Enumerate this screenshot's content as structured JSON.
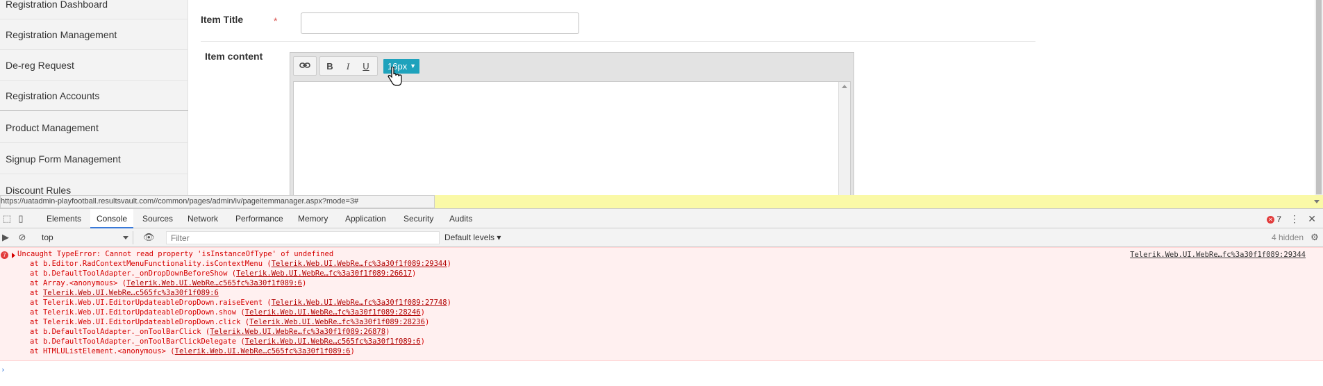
{
  "sidebar": {
    "items": [
      {
        "label": "Registration Dashboard"
      },
      {
        "label": "Registration Management"
      },
      {
        "label": "De-reg Request"
      },
      {
        "label": "Registration Accounts"
      },
      {
        "label": "Product Management"
      },
      {
        "label": "Signup Form Management"
      },
      {
        "label": "Discount Rules"
      }
    ]
  },
  "form": {
    "item_title_label": "Item Title",
    "required_mark": "*",
    "item_title_value": "",
    "item_content_label": "Item content"
  },
  "editor": {
    "toolbar": {
      "link_icon": "link-icon",
      "bold": "B",
      "italic": "I",
      "underline": "U",
      "font_size": "16px"
    }
  },
  "status_bar": {
    "url": "https://uatadmin-playfootball.resultsvault.com//common/pages/admin/iv/pageitemmanager.aspx?mode=3#"
  },
  "devtools": {
    "tabs": [
      "Elements",
      "Console",
      "Sources",
      "Network",
      "Performance",
      "Memory",
      "Application",
      "Security",
      "Audits"
    ],
    "active_tab": "Console",
    "error_count": "7",
    "context": "top",
    "filter_placeholder": "Filter",
    "levels": "Default levels",
    "hidden": "4 hidden",
    "console": {
      "error_count_badge": "7",
      "error_message": "Uncaught TypeError: Cannot read property 'isInstanceOfType' of undefined",
      "source_link": "Telerik.Web.UI.WebRe…fc%3a30f1f089:29344",
      "stack": [
        {
          "prefix": "at b.Editor.RadContextMenuFunctionality.isContextMenu (",
          "link": "Telerik.Web.UI.WebRe…fc%3a30f1f089:29344",
          "suffix": ")"
        },
        {
          "prefix": "at b.DefaultToolAdapter._onDropDownBeforeShow (",
          "link": "Telerik.Web.UI.WebRe…fc%3a30f1f089:26617",
          "suffix": ")"
        },
        {
          "prefix": "at Array.<anonymous> (",
          "link": "Telerik.Web.UI.WebRe…c565fc%3a30f1f089:6",
          "suffix": ")"
        },
        {
          "prefix": "at ",
          "link": "Telerik.Web.UI.WebRe…c565fc%3a30f1f089:6",
          "suffix": ""
        },
        {
          "prefix": "at Telerik.Web.UI.EditorUpdateableDropDown.raiseEvent (",
          "link": "Telerik.Web.UI.WebRe…fc%3a30f1f089:27748",
          "suffix": ")"
        },
        {
          "prefix": "at Telerik.Web.UI.EditorUpdateableDropDown.show (",
          "link": "Telerik.Web.UI.WebRe…fc%3a30f1f089:28246",
          "suffix": ")"
        },
        {
          "prefix": "at Telerik.Web.UI.EditorUpdateableDropDown.click (",
          "link": "Telerik.Web.UI.WebRe…fc%3a30f1f089:28236",
          "suffix": ")"
        },
        {
          "prefix": "at b.DefaultToolAdapter._onToolBarClick (",
          "link": "Telerik.Web.UI.WebRe…fc%3a30f1f089:26878",
          "suffix": ")"
        },
        {
          "prefix": "at b.DefaultToolAdapter._onToolBarClickDelegate (",
          "link": "Telerik.Web.UI.WebRe…c565fc%3a30f1f089:6",
          "suffix": ")"
        },
        {
          "prefix": "at HTMLUListElement.<anonymous> (",
          "link": "Telerik.Web.UI.WebRe…c565fc%3a30f1f089:6",
          "suffix": ")"
        }
      ],
      "prompt": "›"
    }
  },
  "colors": {
    "accent": "#1ea2bc",
    "error_text": "#d60000",
    "error_bg": "#fff0f0",
    "status_yellow": "#faf9a7"
  }
}
